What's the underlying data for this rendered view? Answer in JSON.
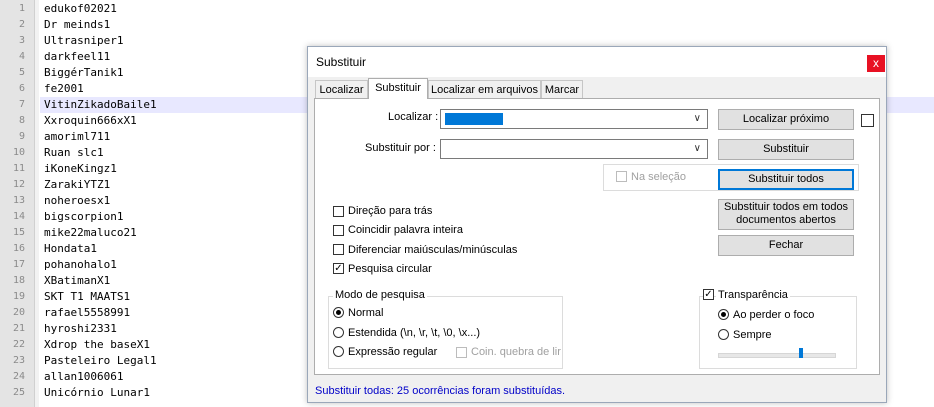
{
  "editor": {
    "current_line_index": 6,
    "lines": [
      {
        "num": "1",
        "text": "edukof02021"
      },
      {
        "num": "2",
        "text": "Dr meinds1"
      },
      {
        "num": "3",
        "text": "Ultrasniper1"
      },
      {
        "num": "4",
        "text": "darkfeel11"
      },
      {
        "num": "5",
        "text": "BiggérTanik1"
      },
      {
        "num": "6",
        "text": "fe2001"
      },
      {
        "num": "7",
        "text": "VitinZikadoBaile1"
      },
      {
        "num": "8",
        "text": "Xxroquin666xX1"
      },
      {
        "num": "9",
        "text": "amoriml711"
      },
      {
        "num": "10",
        "text": "Ruan slc1"
      },
      {
        "num": "11",
        "text": "iKoneKingz1"
      },
      {
        "num": "12",
        "text": "ZarakiYTZ1"
      },
      {
        "num": "13",
        "text": "noheroesx1"
      },
      {
        "num": "14",
        "text": "bigscorpion1"
      },
      {
        "num": "15",
        "text": "mike22maluco21"
      },
      {
        "num": "16",
        "text": "Hondata1"
      },
      {
        "num": "17",
        "text": "pohanohalo1"
      },
      {
        "num": "18",
        "text": "XBatimanX1"
      },
      {
        "num": "19",
        "text": "SKT T1 MAATS1"
      },
      {
        "num": "20",
        "text": "rafael5558991"
      },
      {
        "num": "21",
        "text": "hyroshi2331"
      },
      {
        "num": "22",
        "text": "Xdrop the baseX1"
      },
      {
        "num": "23",
        "text": "Pasteleiro Legal1"
      },
      {
        "num": "24",
        "text": "allan1006061"
      },
      {
        "num": "25",
        "text": "Unicórnio Lunar1"
      }
    ]
  },
  "dialog": {
    "title": "Substituir",
    "close_glyph": "x",
    "tabs": [
      {
        "label": "Localizar",
        "active": false
      },
      {
        "label": "Substituir",
        "active": true
      },
      {
        "label": "Localizar em arquivos",
        "active": false
      },
      {
        "label": "Marcar",
        "active": false
      }
    ],
    "find_label": "Localizar :",
    "find_value": "",
    "replace_label": "Substituir por :",
    "replace_value": "",
    "in_selection_label": "Na seleção",
    "buttons": {
      "find_next": "Localizar próximo",
      "replace": "Substituir",
      "replace_all": "Substituir todos",
      "replace_all_open_line1": "Substituir todos em todos",
      "replace_all_open_line2": "documentos abertos",
      "close": "Fechar"
    },
    "options": [
      {
        "label": "Direção para trás",
        "checked": false
      },
      {
        "label": "Coincidir palavra inteira",
        "checked": false
      },
      {
        "label": "Diferenciar maiúsculas/minúsculas",
        "checked": false
      },
      {
        "label": "Pesquisa circular",
        "checked": true
      }
    ],
    "search_mode": {
      "title": "Modo de pesquisa",
      "normal": "Normal",
      "extended": "Estendida  (\\n, \\r, \\t, \\0, \\x...)",
      "regex": "Expressão regular",
      "dot_newline": "Coin. quebra de lir",
      "selected": "normal"
    },
    "transparency": {
      "label": "Transparência",
      "checked": true,
      "on_focus_lost": "Ao perder o foco",
      "always": "Sempre",
      "selected": "on_focus_lost",
      "level": 0.7
    },
    "status": "Substituir todas: 25 ocorrências foram substituídas."
  },
  "colors": {
    "accent": "#0078d7",
    "status_text": "#0000c8",
    "close_button": "#e81123",
    "current_line": "#e8e8ff"
  }
}
